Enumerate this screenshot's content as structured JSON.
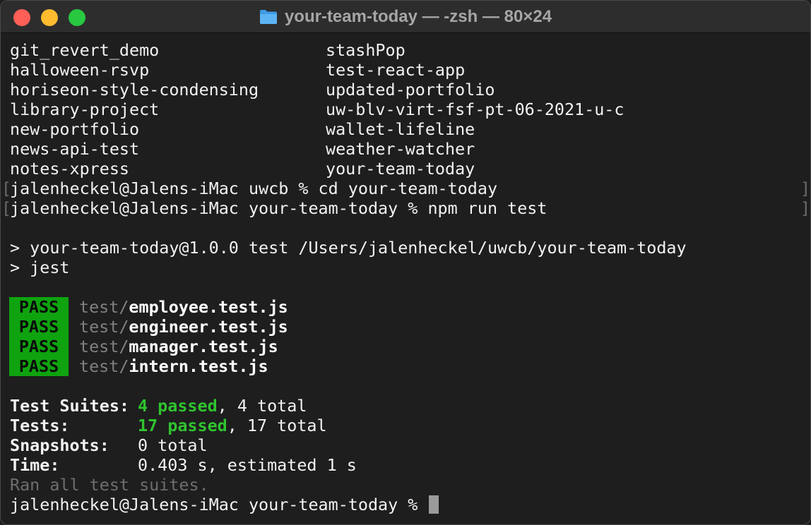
{
  "window": {
    "title": "your-team-today — -zsh — 80×24"
  },
  "listing": {
    "left": [
      "git_revert_demo",
      "halloween-rsvp",
      "horiseon-style-condensing",
      "library-project",
      "new-portfolio",
      "news-api-test",
      "notes-xpress"
    ],
    "right": [
      "stashPop",
      "test-react-app",
      "updated-portfolio",
      "uw-blv-virt-fsf-pt-06-2021-u-c",
      "wallet-lifeline",
      "weather-watcher",
      "your-team-today"
    ]
  },
  "commands": {
    "cmd1": "jalenheckel@Jalens-iMac uwcb % cd your-team-today",
    "cmd2": "jalenheckel@Jalens-iMac your-team-today % npm run test"
  },
  "npm": {
    "line1": "> your-team-today@1.0.0 test /Users/jalenheckel/uwcb/your-team-today",
    "line2": "> jest"
  },
  "tests": {
    "badge": "PASS",
    "dir": "test/",
    "files": [
      "employee.test.js",
      "engineer.test.js",
      "manager.test.js",
      "intern.test.js"
    ]
  },
  "summary": {
    "suites_label": "Test Suites:",
    "suites_passed": "4 passed",
    "suites_total": ", 4 total",
    "tests_label": "Tests:",
    "tests_passed": "17 passed",
    "tests_total": ", 17 total",
    "snapshots_label": "Snapshots:",
    "snapshots_value": "0 total",
    "time_label": "Time:",
    "time_value": "0.403 s, estimated 1 s",
    "ran_all": "Ran all test suites."
  },
  "prompt": "jalenheckel@Jalens-iMac your-team-today % ",
  "colors": {
    "pass_bg": "#0fa30f",
    "green_text": "#2fc42f",
    "close": "#fe5f57",
    "minimize": "#febc2e",
    "maximize": "#28c840"
  }
}
